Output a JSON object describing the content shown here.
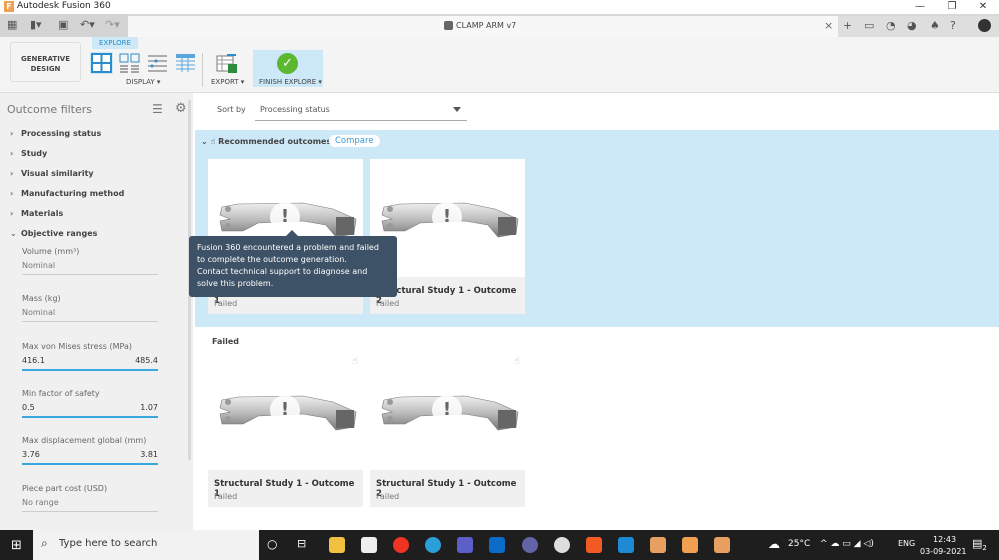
{
  "window": {
    "title": "Autodesk Fusion 360",
    "logo": "F",
    "minimize": "—",
    "restore": "❐",
    "close": "✕"
  },
  "doc_tab": {
    "name": "CLAMP ARM v7",
    "close": "×"
  },
  "tab_icons": [
    "plus-icon",
    "comment-icon",
    "extensions-icon",
    "job-status-icon",
    "bell-icon",
    "help-icon",
    "avatar"
  ],
  "ribbon": {
    "workspace": "GENERATIVE DESIGN",
    "explore_tab": "EXPLORE",
    "display": "DISPLAY ▾",
    "export": "EXPORT ▾",
    "finish": "FINISH EXPLORE ▾"
  },
  "filters": {
    "title": "Outcome filters",
    "items": [
      "Processing status",
      "Study",
      "Visual similarity",
      "Manufacturing method",
      "Materials",
      "Objective ranges"
    ],
    "ranges": [
      {
        "label": "Volume (mm³)",
        "min": "Nominal",
        "max": "",
        "active": false
      },
      {
        "label": "Mass (kg)",
        "min": "Nominal",
        "max": "",
        "active": false
      },
      {
        "label": "Max von Mises stress (MPa)",
        "min": "416.1",
        "max": "485.4",
        "active": true
      },
      {
        "label": "Min factor of safety",
        "min": "0.5",
        "max": "1.07",
        "active": true
      },
      {
        "label": "Max displacement global (mm)",
        "min": "3.76",
        "max": "3.81",
        "active": true
      },
      {
        "label": "Piece part cost (USD)",
        "min": "No range",
        "max": "",
        "active": false
      }
    ]
  },
  "sort": {
    "label": "Sort by",
    "value": "Processing status"
  },
  "recommended": {
    "title": "Recommended outcomes",
    "compare": "Compare",
    "cards": [
      {
        "title": "Structural Study 1 - Outcome 1",
        "status": "Failed"
      },
      {
        "title": "Structural Study 1 - Outcome 2",
        "status": "Failed"
      }
    ]
  },
  "failed": {
    "title": "Failed",
    "cards": [
      {
        "title": "Structural Study 1 - Outcome 1",
        "status": "Failed"
      },
      {
        "title": "Structural Study 1 - Outcome 2",
        "status": "Failed"
      }
    ]
  },
  "tooltip": {
    "line1": "Fusion 360 encountered a problem and failed to complete the outcome generation.",
    "line2": "Contact technical support to diagnose and solve this problem."
  },
  "taskbar": {
    "search_placeholder": "Type here to search",
    "weather": "25°C",
    "lang": "ENG",
    "time": "12:43",
    "date": "03-09-2021",
    "notifications": "2"
  }
}
